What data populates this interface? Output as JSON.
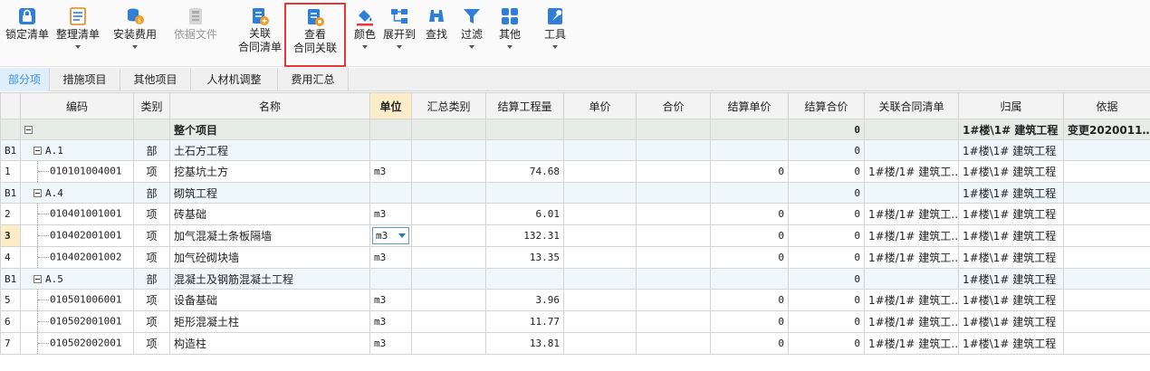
{
  "toolbar": {
    "buttons": [
      {
        "id": "lock",
        "label": "锁定清单",
        "icon": "lock-icon",
        "has_caret": false
      },
      {
        "id": "organize",
        "label": "整理清单",
        "icon": "organize-list-icon",
        "has_caret": true
      },
      {
        "id": "install_fee",
        "label": "安装费用",
        "icon": "coins-icon",
        "has_caret": true
      },
      {
        "id": "by_file",
        "label": "依据文件",
        "icon": "file-icon",
        "has_caret": false,
        "disabled": true
      },
      {
        "id": "link_contract",
        "label": "关联",
        "label2": "合同清单",
        "icon": "link-contract-icon"
      },
      {
        "id": "view_contract",
        "label": "查看",
        "label2": "合同关联",
        "icon": "view-contract-icon"
      },
      {
        "id": "color",
        "label": "颜色",
        "icon": "paint-bucket-icon",
        "has_caret": true
      },
      {
        "id": "expand",
        "label": "展开到",
        "icon": "tree-expand-icon",
        "has_caret": true
      },
      {
        "id": "find",
        "label": "查找",
        "icon": "binoculars-icon",
        "has_caret": false
      },
      {
        "id": "filter",
        "label": "过滤",
        "icon": "filter-icon",
        "has_caret": true
      },
      {
        "id": "other",
        "label": "其他",
        "icon": "grid-apps-icon",
        "has_caret": true
      },
      {
        "id": "tools",
        "label": "工具",
        "icon": "wrench-icon",
        "has_caret": true
      }
    ]
  },
  "tabs": [
    "部分项",
    "措施项目",
    "其他项目",
    "人材机调整",
    "费用汇总"
  ],
  "columns": [
    "编码",
    "类别",
    "名称",
    "单位",
    "汇总类别",
    "结算工程量",
    "单价",
    "合价",
    "结算单价",
    "结算合价",
    "关联合同清单",
    "归属",
    "依据"
  ],
  "rows": [
    {
      "type": "whole",
      "rownum": "",
      "code": "",
      "cat": "",
      "name": "整个项目",
      "unit": "",
      "sum_cat": "",
      "qty": "",
      "price": "",
      "total": "",
      "s_price": "",
      "s_total": "0",
      "contract": "",
      "belong": "1#楼\\1# 建筑工程",
      "basis": "变更2020011…"
    },
    {
      "type": "part",
      "rownum": "B1",
      "code": "A.1",
      "cat": "部",
      "name": "土石方工程",
      "unit": "",
      "sum_cat": "",
      "qty": "",
      "price": "",
      "total": "",
      "s_price": "",
      "s_total": "0",
      "contract": "",
      "belong": "1#楼\\1# 建筑工程",
      "basis": ""
    },
    {
      "type": "item",
      "rownum": "1",
      "code": "010101004001",
      "cat": "项",
      "name": "挖基坑土方",
      "unit": "m3",
      "sum_cat": "",
      "qty": "74.68",
      "price": "",
      "total": "",
      "s_price": "0",
      "s_total": "0",
      "contract": "1#楼/1# 建筑工…",
      "belong": "1#楼\\1# 建筑工程",
      "basis": ""
    },
    {
      "type": "part",
      "rownum": "B1",
      "code": "A.4",
      "cat": "部",
      "name": "砌筑工程",
      "unit": "",
      "sum_cat": "",
      "qty": "",
      "price": "",
      "total": "",
      "s_price": "",
      "s_total": "0",
      "contract": "",
      "belong": "1#楼\\1# 建筑工程",
      "basis": ""
    },
    {
      "type": "item",
      "rownum": "2",
      "code": "010401001001",
      "cat": "项",
      "name": "砖基础",
      "unit": "m3",
      "sum_cat": "",
      "qty": "6.01",
      "price": "",
      "total": "",
      "s_price": "0",
      "s_total": "0",
      "contract": "1#楼/1# 建筑工…",
      "belong": "1#楼\\1# 建筑工程",
      "basis": ""
    },
    {
      "type": "item",
      "rownum": "3",
      "current": true,
      "code": "010402001001",
      "cat": "项",
      "name": "加气混凝土条板隔墙",
      "unit": "m3",
      "sum_cat": "",
      "qty": "132.31",
      "price": "",
      "total": "",
      "s_price": "0",
      "s_total": "0",
      "contract": "1#楼/1# 建筑工…",
      "belong": "1#楼\\1# 建筑工程",
      "basis": ""
    },
    {
      "type": "item",
      "rownum": "4",
      "code": "010402001002",
      "cat": "项",
      "name": "加气砼砌块墙",
      "unit": "m3",
      "sum_cat": "",
      "qty": "13.35",
      "price": "",
      "total": "",
      "s_price": "0",
      "s_total": "0",
      "contract": "1#楼/1# 建筑工…",
      "belong": "1#楼\\1# 建筑工程",
      "basis": ""
    },
    {
      "type": "part",
      "rownum": "B1",
      "code": "A.5",
      "cat": "部",
      "name": "混凝土及钢筋混凝土工程",
      "unit": "",
      "sum_cat": "",
      "qty": "",
      "price": "",
      "total": "",
      "s_price": "",
      "s_total": "0",
      "contract": "",
      "belong": "1#楼\\1# 建筑工程",
      "basis": ""
    },
    {
      "type": "item",
      "rownum": "5",
      "code": "010501006001",
      "cat": "项",
      "name": "设备基础",
      "unit": "m3",
      "sum_cat": "",
      "qty": "3.96",
      "price": "",
      "total": "",
      "s_price": "0",
      "s_total": "0",
      "contract": "1#楼/1# 建筑工…",
      "belong": "1#楼\\1# 建筑工程",
      "basis": ""
    },
    {
      "type": "item",
      "rownum": "6",
      "code": "010502001001",
      "cat": "项",
      "name": "矩形混凝土柱",
      "unit": "m3",
      "sum_cat": "",
      "qty": "11.77",
      "price": "",
      "total": "",
      "s_price": "0",
      "s_total": "0",
      "contract": "1#楼/1# 建筑工…",
      "belong": "1#楼\\1# 建筑工程",
      "basis": ""
    },
    {
      "type": "item",
      "rownum": "7",
      "code": "010502002001",
      "cat": "项",
      "name": "构造柱",
      "unit": "m3",
      "sum_cat": "",
      "qty": "13.81",
      "price": "",
      "total": "",
      "s_price": "0",
      "s_total": "0",
      "contract": "1#楼/1# 建筑工…",
      "belong": "1#楼\\1# 建筑工程",
      "basis": ""
    }
  ]
}
